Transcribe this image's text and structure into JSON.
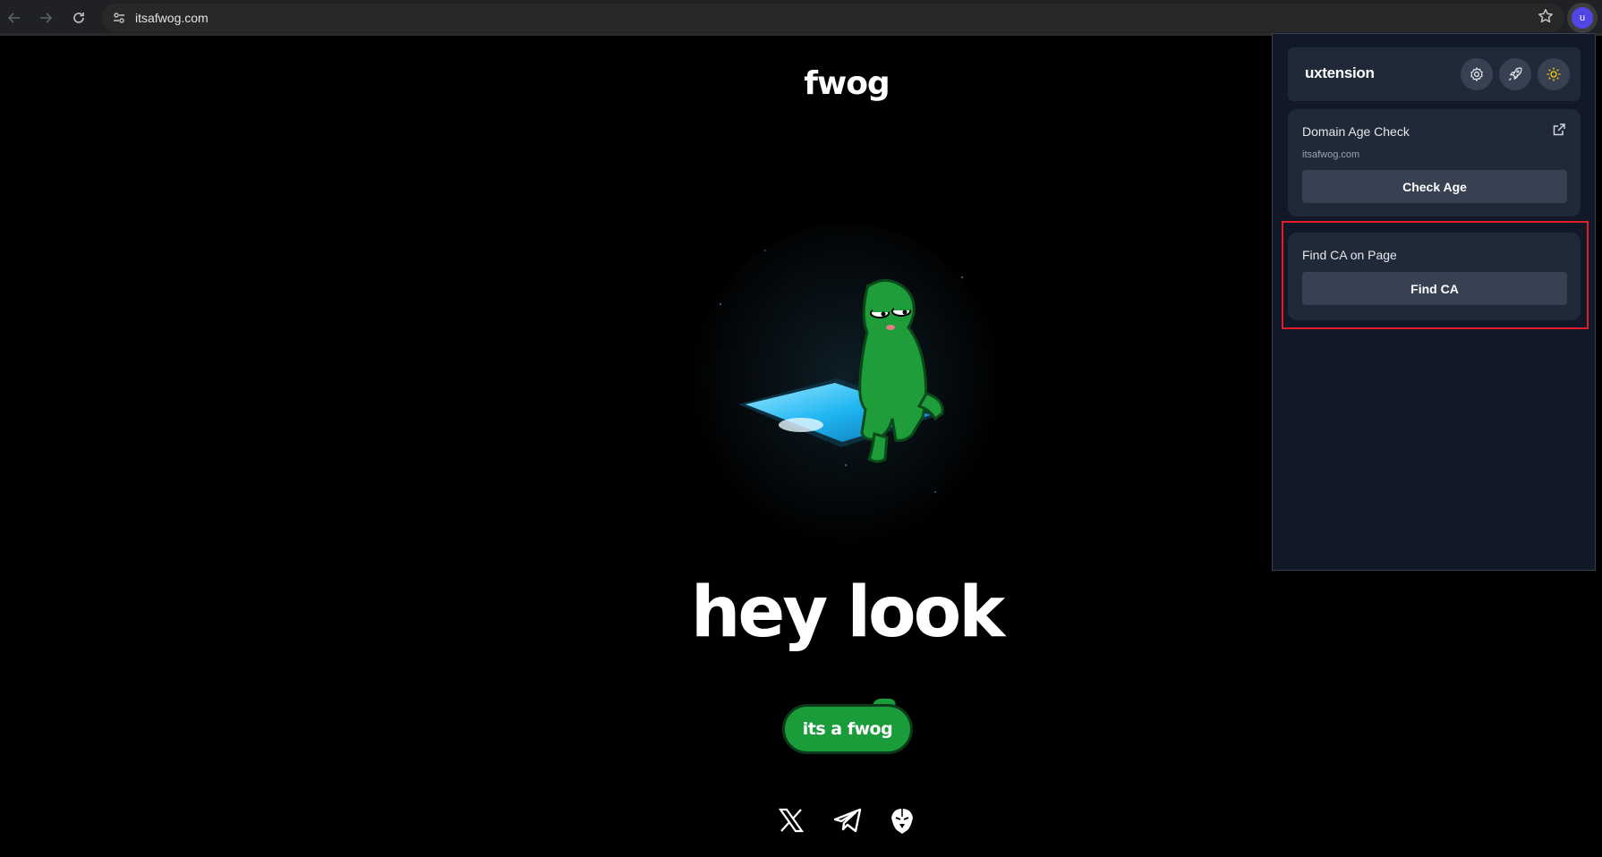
{
  "browser": {
    "url": "itsafwog.com",
    "back_icon": "arrow-left",
    "forward_icon": "arrow-right",
    "reload_icon": "reload",
    "site_info_icon": "tune",
    "bookmark_icon": "star",
    "profile_initial": "u"
  },
  "page": {
    "logo": "fwog",
    "headline": "hey look",
    "cta_label": "its a fwog",
    "socials": [
      {
        "icon": "x-logo-icon"
      },
      {
        "icon": "telegram-icon"
      },
      {
        "icon": "eagle-icon"
      }
    ]
  },
  "extension": {
    "title": "uxtension",
    "header_buttons": [
      "gear-icon",
      "rocket-icon",
      "sun-icon"
    ],
    "domain_card": {
      "title": "Domain Age Check",
      "domain": "itsafwog.com",
      "button": "Check Age"
    },
    "ca_card": {
      "title": "Find CA on Page",
      "button": "Find CA"
    }
  },
  "colors": {
    "accent_green": "#1a9c3a",
    "popup_bg": "#111827",
    "card_bg": "#1f2937",
    "highlight": "#e11d2a",
    "avatar": "#4f46e5"
  }
}
